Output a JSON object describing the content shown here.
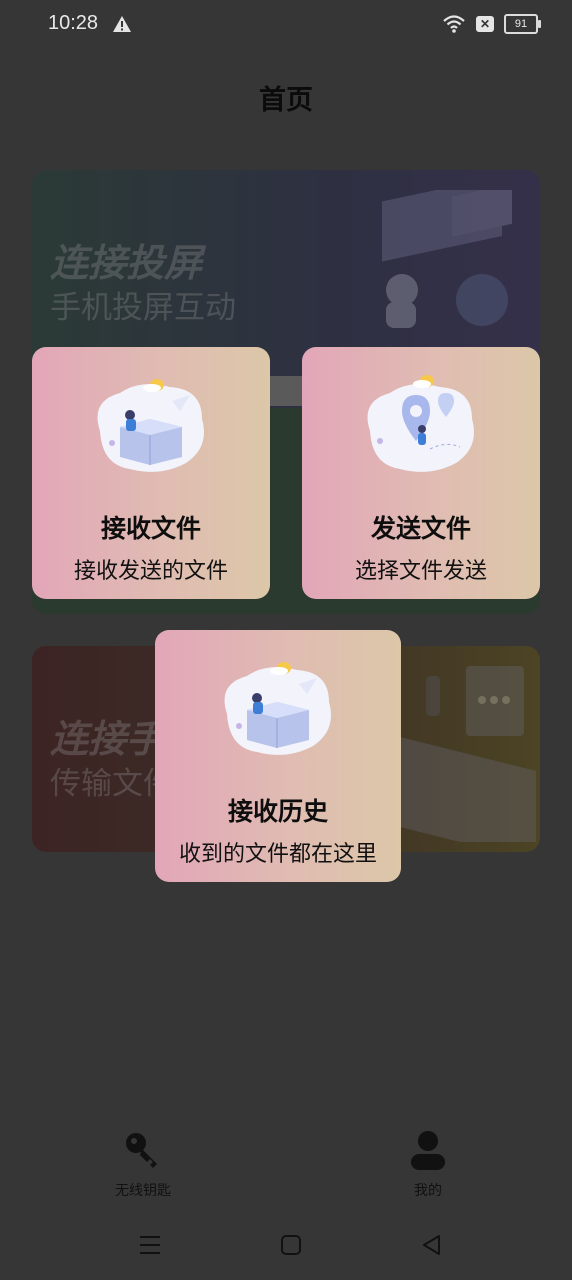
{
  "status_bar": {
    "time": "10:28",
    "battery": "91"
  },
  "header": {
    "title": "首页"
  },
  "background_cards": [
    {
      "title": "连接投屏",
      "subtitle": "手机投屏互动"
    },
    {
      "title": "连接手",
      "subtitle": "传输文件"
    }
  ],
  "popup_cards": [
    {
      "title": "接收文件",
      "subtitle": "接收发送的文件",
      "icon": "receive-box-illustration"
    },
    {
      "title": "发送文件",
      "subtitle": "选择文件发送",
      "icon": "send-location-illustration"
    },
    {
      "title": "接收历史",
      "subtitle": "收到的文件都在这里",
      "icon": "history-box-illustration"
    }
  ],
  "bottom_nav": {
    "items": [
      {
        "label": "无线钥匙",
        "icon": "key-icon",
        "color": "#111111"
      },
      {
        "label": "我的",
        "icon": "person-icon",
        "color": "#111111"
      }
    ]
  },
  "colors": {
    "background": "#363636",
    "card_gradient_start": "#e2a6b8",
    "card_gradient_end": "#dcc7a8"
  }
}
